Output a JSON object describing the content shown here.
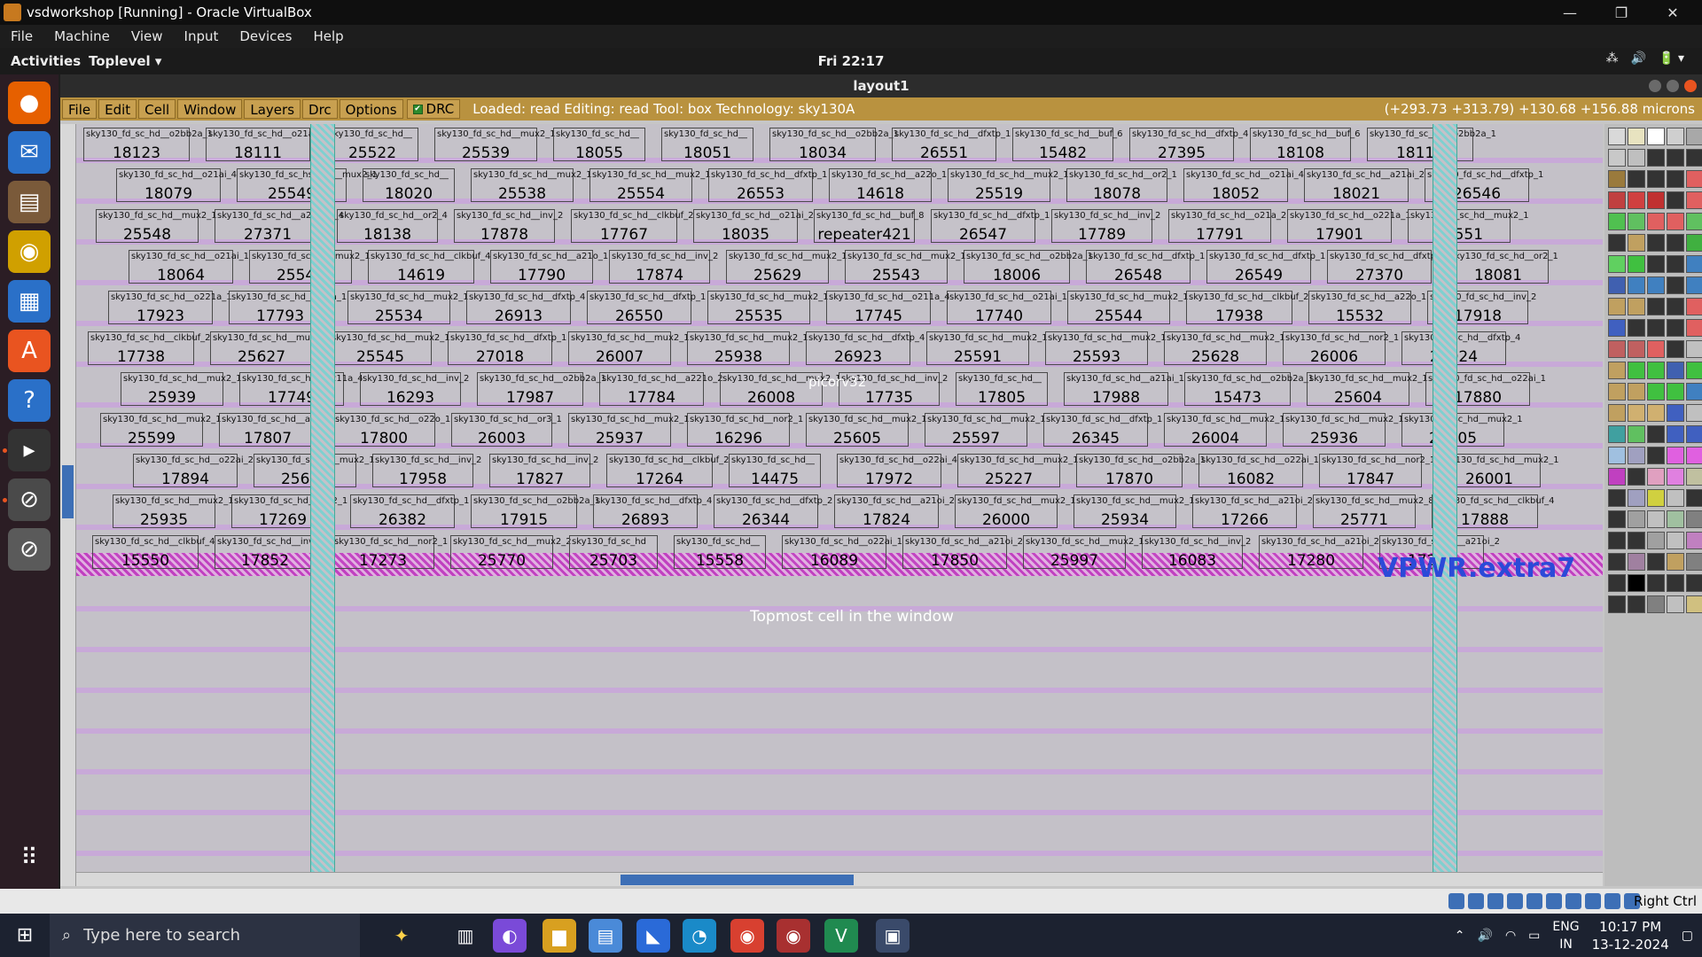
{
  "vbox": {
    "title": "vsdworkshop [Running] - Oracle VirtualBox",
    "menu": [
      "File",
      "Machine",
      "View",
      "Input",
      "Devices",
      "Help"
    ],
    "window_controls": [
      "—",
      "❐",
      "✕"
    ],
    "host_key": "Right Ctrl"
  },
  "gnome": {
    "activities": "Activities",
    "app_menu": "Toplevel ▾",
    "clock": "Fri 22:17",
    "tray": [
      "⁂",
      "🔊",
      "🔋 ▾"
    ]
  },
  "magic": {
    "title": "layout1",
    "menu": [
      "File",
      "Edit",
      "Cell",
      "Window",
      "Layers",
      "Drc",
      "Options"
    ],
    "drc_label": "DRC",
    "status": "Loaded: read Editing: read Tool: box  Technology: sky130A",
    "coords": "(+293.73 +313.79) +130.68 +156.88 microns",
    "vpwr_label": "VPWR.extra7",
    "topmost_msg": "Topmost cell in the window",
    "hint_label": "picorv32",
    "cells": [
      {
        "t1": "sky130_fd_sc_hd__o2bb2a_1",
        "t2": "18123"
      },
      {
        "t1": "sky130_fd_sc_hd__o21ai_0",
        "t2": "18111"
      },
      {
        "t1": "sky130_fd_sc_hd__",
        "t2": "25522"
      },
      {
        "t1": "sky130_fd_sc_hd__mux2_1",
        "t2": "25539"
      },
      {
        "t1": "sky130_fd_sc_hd__",
        "t2": "18055"
      },
      {
        "t1": "sky130_fd_sc_hd__",
        "t2": "18051"
      },
      {
        "t1": "sky130_fd_sc_hd__o2bb2a_1",
        "t2": "18034"
      },
      {
        "t1": "sky130_fd_sc_hd__dfxtp_1",
        "t2": "26551"
      },
      {
        "t1": "sky130_fd_sc_hd__buf_6",
        "t2": "15482"
      },
      {
        "t1": "sky130_fd_sc_hd__dfxtp_4",
        "t2": "27395"
      },
      {
        "t1": "sky130_fd_sc_hd__buf_6",
        "t2": "18108"
      },
      {
        "t1": "sky130_fd_sc_hd__o2bb2a_1",
        "t2": "18110"
      },
      {
        "t1": "sky130_fd_sc_hd__o21ai_4",
        "t2": "18079"
      },
      {
        "t1": "sky130_fd_sc_hsc_hd__mux2_1",
        "t2": "25549"
      },
      {
        "t1": "sky130_fd_sc_hd__",
        "t2": "18020"
      },
      {
        "t1": "sky130_fd_sc_hd__mux2_1",
        "t2": "25538"
      },
      {
        "t1": "sky130_fd_sc_hd__mux2_1",
        "t2": "25554"
      },
      {
        "t1": "sky130_fd_sc_hd__dfxtp_1",
        "t2": "26553"
      },
      {
        "t1": "sky130_fd_sc_hd__a22o_1",
        "t2": "14618"
      },
      {
        "t1": "sky130_fd_sc_hd__mux2_1",
        "t2": "25519"
      },
      {
        "t1": "sky130_fd_sc_hd__or2_1",
        "t2": "18078"
      },
      {
        "t1": "sky130_fd_sc_hd__o21ai_4",
        "t2": "18052"
      },
      {
        "t1": "sky130_fd_sc_hd__a21ai_2",
        "t2": "18021"
      },
      {
        "t1": "sky130_fd_sc_hd__dfxtp_1",
        "t2": "26546"
      },
      {
        "t1": "sky130_fd_sc_hd__mux2_1",
        "t2": "25548"
      },
      {
        "t1": "sky130_fd_sc_hd__a2bb2o_4",
        "t2": "27371"
      },
      {
        "t1": "sky130_fd_sc_hd__or2_4",
        "t2": "18138"
      },
      {
        "t1": "sky130_fd_sc_hd__inv_2",
        "t2": "17878"
      },
      {
        "t1": "sky130_fd_sc_hd__clkbuf_2",
        "t2": "17767"
      },
      {
        "t1": "sky130_fd_sc_hd__o21ai_2",
        "t2": "18035"
      },
      {
        "t1": "sky130_fd_sc_hd__buf_8",
        "t2": "repeater421"
      },
      {
        "t1": "sky130_fd_sc_hd__dfxtp_1",
        "t2": "26547"
      },
      {
        "t1": "sky130_fd_sc_hd__inv_2",
        "t2": "17789"
      },
      {
        "t1": "sky130_fd_sc_hd__o21a_2",
        "t2": "17791"
      },
      {
        "t1": "sky130_fd_sc_hd__o221a_1",
        "t2": "17901"
      },
      {
        "t1": "sky130_fd_sc_hd__mux2_1",
        "t2": "25551"
      },
      {
        "t1": "sky130_fd_sc_hd__o21ai_1",
        "t2": "18064"
      },
      {
        "t1": "sky130_fd_sc_hd__mux2_1",
        "t2": "25542"
      },
      {
        "t1": "sky130_fd_sc_hd__clkbuf_4",
        "t2": "14619"
      },
      {
        "t1": "sky130_fd_sc_hd__a21o_1",
        "t2": "17790"
      },
      {
        "t1": "sky130_fd_sc_hd__inv_2",
        "t2": "17874"
      },
      {
        "t1": "sky130_fd_sc_hd__mux2_1",
        "t2": "25629"
      },
      {
        "t1": "sky130_fd_sc_hd__mux2_1",
        "t2": "25543"
      },
      {
        "t1": "sky130_fd_sc_hd__o2bb2a_1",
        "t2": "18006"
      },
      {
        "t1": "sky130_fd_sc_hd__dfxtp_1",
        "t2": "26548"
      },
      {
        "t1": "sky130_fd_sc_hd__dfxtp_1",
        "t2": "26549"
      },
      {
        "t1": "sky130_fd_sc_hd__dfxtp_4",
        "t2": "27370"
      },
      {
        "t1": "sky130_fd_sc_hd__or2_1",
        "t2": "18081"
      },
      {
        "t1": "sky130_fd_sc_hd__o221a_1",
        "t2": "17923"
      },
      {
        "t1": "sky130_fd_sc_hd__o22a_1",
        "t2": "17793"
      },
      {
        "t1": "sky130_fd_sc_hd__mux2_1",
        "t2": "25534"
      },
      {
        "t1": "sky130_fd_sc_hd__dfxtp_4",
        "t2": "26913"
      },
      {
        "t1": "sky130_fd_sc_hd__dfxtp_1",
        "t2": "26550"
      },
      {
        "t1": "sky130_fd_sc_hd__mux2_1",
        "t2": "25535"
      },
      {
        "t1": "sky130_fd_sc_hd__o211a_4",
        "t2": "17745"
      },
      {
        "t1": "sky130_fd_sc_hd__o21ai_1",
        "t2": "17740"
      },
      {
        "t1": "sky130_fd_sc_hd__mux2_1",
        "t2": "25544"
      },
      {
        "t1": "sky130_fd_sc_hd__clkbuf_2",
        "t2": "17938"
      },
      {
        "t1": "sky130_fd_sc_hd__a22o_1",
        "t2": "15532"
      },
      {
        "t1": "sky130_fd_sc_hd__inv_2",
        "t2": "17918"
      },
      {
        "t1": "sky130_fd_sc_hd__clkbuf_2",
        "t2": "17738"
      },
      {
        "t1": "sky130_fd_sc_hd__mux2_1",
        "t2": "25627"
      },
      {
        "t1": "sky130_fd_sc_hd__mux2_1",
        "t2": "25545"
      },
      {
        "t1": "sky130_fd_sc_hd__dfxtp_1",
        "t2": "27018"
      },
      {
        "t1": "sky130_fd_sc_hd__mux2_1",
        "t2": "26007"
      },
      {
        "t1": "sky130_fd_sc_hd__mux2_1",
        "t2": "25938"
      },
      {
        "t1": "sky130_fd_sc_hd__dfxtp_4",
        "t2": "26923"
      },
      {
        "t1": "sky130_fd_sc_hd__mux2_1",
        "t2": "25591"
      },
      {
        "t1": "sky130_fd_sc_hd__mux2_1",
        "t2": "25593"
      },
      {
        "t1": "sky130_fd_sc_hd__mux2_1",
        "t2": "25628"
      },
      {
        "t1": "sky130_fd_sc_hd__nor2_1",
        "t2": "26006"
      },
      {
        "t1": "sky130_fd_sc_hd__dfxtp_4",
        "t2": "26924"
      },
      {
        "t1": "sky130_fd_sc_hd__mux2_1",
        "t2": "25939"
      },
      {
        "t1": "sky130_fd_sc_hd__o211a_4",
        "t2": "17749"
      },
      {
        "t1": "sky130_fd_sc_hd__inv_2",
        "t2": "16293"
      },
      {
        "t1": "sky130_fd_sc_hd__o2bb2a_1",
        "t2": "17987"
      },
      {
        "t1": "sky130_fd_sc_hd__a221o_2",
        "t2": "17784"
      },
      {
        "t1": "sky130_fd_sc_hd__mux2_1",
        "t2": "26008"
      },
      {
        "t1": "sky130_fd_sc_hd__inv_2",
        "t2": "17735"
      },
      {
        "t1": "sky130_fd_sc_hd__",
        "t2": "17805"
      },
      {
        "t1": "sky130_fd_sc_hd__a21ai_1",
        "t2": "17988"
      },
      {
        "t1": "sky130_fd_sc_hd__o2bb2a_1",
        "t2": "15473"
      },
      {
        "t1": "sky130_fd_sc_hd__mux2_1",
        "t2": "25604"
      },
      {
        "t1": "sky130_fd_sc_hd__o22ai_1",
        "t2": "17880"
      },
      {
        "t1": "sky130_fd_sc_hd__mux2_1",
        "t2": "25599"
      },
      {
        "t1": "sky130_fd_sc_hd__a31",
        "t2": "17807"
      },
      {
        "t1": "sky130_fd_sc_hd__o22o_1",
        "t2": "17800"
      },
      {
        "t1": "sky130_fd_sc_hd__or3_1",
        "t2": "26003"
      },
      {
        "t1": "sky130_fd_sc_hd__mux2_1",
        "t2": "25937"
      },
      {
        "t1": "sky130_fd_sc_hd__nor2_1",
        "t2": "16296"
      },
      {
        "t1": "sky130_fd_sc_hd__mux2_1",
        "t2": "25605"
      },
      {
        "t1": "sky130_fd_sc_hd__mux2_1",
        "t2": "25597"
      },
      {
        "t1": "sky130_fd_sc_hd__dfxtp_1",
        "t2": "26345"
      },
      {
        "t1": "sky130_fd_sc_hd__mux2_1",
        "t2": "26004"
      },
      {
        "t1": "sky130_fd_sc_hd__mux2_1",
        "t2": "25936"
      },
      {
        "t1": "sky130_fd_sc_hd__mux2_1",
        "t2": "26005"
      },
      {
        "t1": "sky130_fd_sc_hd__o22ai_2",
        "t2": "17894"
      },
      {
        "t1": "sky130_fd_sc_hd__mux2_1",
        "t2": "25603"
      },
      {
        "t1": "sky130_fd_sc_hd__inv_2",
        "t2": "17958"
      },
      {
        "t1": "sky130_fd_sc_hd__inv_2",
        "t2": "17827"
      },
      {
        "t1": "sky130_fd_sc_hd__clkbuf_2",
        "t2": "17264"
      },
      {
        "t1": "sky130_fd_sc_hd__",
        "t2": "14475"
      },
      {
        "t1": "sky130_fd_sc_hd__o22ai_4",
        "t2": "17972"
      },
      {
        "t1": "sky130_fd_sc_hd__mux2_1",
        "t2": "25227"
      },
      {
        "t1": "sky130_fd_sc_hd__o2bb2a_1",
        "t2": "17870"
      },
      {
        "t1": "sky130_fd_sc_hd__o22ai_1",
        "t2": "16082"
      },
      {
        "t1": "sky130_fd_sc_hd__nor2_1",
        "t2": "17847"
      },
      {
        "t1": "sky130_fd_sc_hd__mux2_1",
        "t2": "26001"
      },
      {
        "t1": "sky130_fd_sc_hd__mux2_1",
        "t2": "25935"
      },
      {
        "t1": "sky130_fd_sc_hd__nor2_1",
        "t2": "17269"
      },
      {
        "t1": "sky130_fd_sc_hd__dfxtp_1",
        "t2": "26382"
      },
      {
        "t1": "sky130_fd_sc_hd__o2bb2a_1",
        "t2": "17915"
      },
      {
        "t1": "sky130_fd_sc_hd__dfxtp_4",
        "t2": "26893"
      },
      {
        "t1": "sky130_fd_sc_hd__dfxtp_2",
        "t2": "26344"
      },
      {
        "t1": "sky130_fd_sc_hd__a21oi_2",
        "t2": "17824"
      },
      {
        "t1": "sky130_fd_sc_hd__mux2_1",
        "t2": "26000"
      },
      {
        "t1": "sky130_fd_sc_hd__mux2_1",
        "t2": "25934"
      },
      {
        "t1": "sky130_fd_sc_hd__a21oi_2",
        "t2": "17266"
      },
      {
        "t1": "sky130_fd_sc_hd__mux2_8",
        "t2": "25771"
      },
      {
        "t1": "sky130_fd_sc_hd__clkbuf_4",
        "t2": "17888"
      },
      {
        "t1": "sky130_fd_sc_hd__clkbuf_4",
        "t2": "15550"
      },
      {
        "t1": "sky130_fd_sc_hd__inv_2",
        "t2": "17852"
      },
      {
        "t1": "sky130_fd_sc_hd__nor2_1",
        "t2": "17273"
      },
      {
        "t1": "sky130_fd_sc_hd__mux2_2",
        "t2": "25770"
      },
      {
        "t1": "sky130_fd_sc_hd",
        "t2": "25703"
      },
      {
        "t1": "sky130_fd_sc_hd__",
        "t2": "15558"
      },
      {
        "t1": "sky130_fd_sc_hd__o22ai_1",
        "t2": "16089"
      },
      {
        "t1": "sky130_fd_sc_hd__a21oi_2",
        "t2": "17850"
      },
      {
        "t1": "sky130_fd_sc_hd__mux2_1",
        "t2": "25997"
      },
      {
        "t1": "sky130_fd_sc_hd__inv_2",
        "t2": "16083"
      },
      {
        "t1": "sky130_fd_sc_hd__a21oi_2",
        "t2": "17280"
      },
      {
        "t1": "sky130_fd_sc_hd__a21oi_2",
        "t2": "17275"
      }
    ],
    "palette_colors": [
      "#d9d9d9",
      "#e8e3c0",
      "#ffffff",
      "#cfcfcf",
      "#a8a8a8",
      "#c8c8c8",
      "#bfbfbf",
      "#333333",
      "#333333",
      "#333333",
      "#9a7a3c",
      "#333333",
      "#333333",
      "#333333",
      "#e06060",
      "#c04040",
      "#d04040",
      "#c03030",
      "#333333",
      "#e06060",
      "#50c050",
      "#60c060",
      "#e06060",
      "#e06060",
      "#60c060",
      "#333333",
      "#c0a060",
      "#333333",
      "#333333",
      "#40b040",
      "#60d060",
      "#40c040",
      "#333333",
      "#333333",
      "#4080c0",
      "#4060b0",
      "#4080c0",
      "#4080c0",
      "#333333",
      "#4080c0",
      "#c0a060",
      "#c0a060",
      "#333333",
      "#333333",
      "#e06060",
      "#4060c0",
      "#333333",
      "#333333",
      "#333333",
      "#e06060",
      "#c06060",
      "#c06060",
      "#e06060",
      "#333333",
      "#c0c0c0",
      "#c0a060",
      "#40c040",
      "#40c040",
      "#4060b0",
      "#40c040",
      "#c0a060",
      "#c0a060",
      "#40c040",
      "#40c040",
      "#4080c0",
      "#c0a060",
      "#d0b070",
      "#d0b070",
      "#4060c0",
      "#c0c0c0",
      "#40a0a0",
      "#60c060",
      "#333333",
      "#4060c0",
      "#4060c0",
      "#a0c0e0",
      "#a0a0c0",
      "#333333",
      "#e060e0",
      "#e060e0",
      "#c040c0",
      "#333333",
      "#e0a0c0",
      "#e080e0",
      "#c0c0a0",
      "#333333",
      "#a0a0c0",
      "#d0d040",
      "#c0c0c0",
      "#333333",
      "#333333",
      "#a0a0a0",
      "#c0c0c0",
      "#a0c0a0",
      "#808080",
      "#333333",
      "#333333",
      "#a0a0a0",
      "#c0c0c0",
      "#c080c0",
      "#333333",
      "#a080a0",
      "#333333",
      "#c0a060",
      "#808080",
      "#333333",
      "#000000",
      "#333333",
      "#333333",
      "#333333",
      "#333333",
      "#333333",
      "#808080",
      "#c0c0c0",
      "#d0c080"
    ]
  },
  "win": {
    "search_placeholder": "Type here to search",
    "time": "10:17 PM",
    "date": "13-12-2024",
    "lang1": "ENG",
    "lang2": "IN"
  }
}
